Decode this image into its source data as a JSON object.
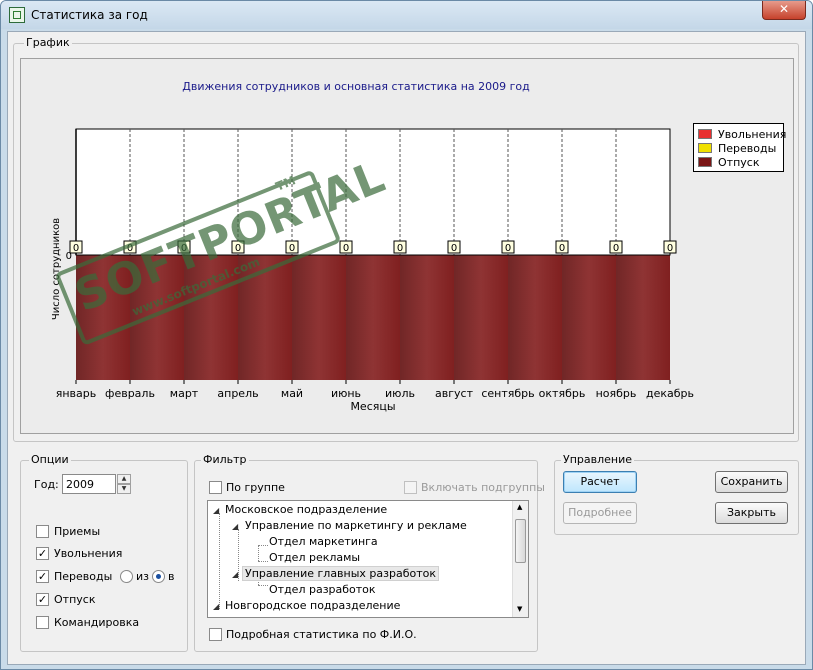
{
  "window": {
    "title": "Статистика за год",
    "close_label": "✕"
  },
  "chart_group": {
    "label": "График"
  },
  "chart_data": {
    "type": "bar",
    "title": "Движения сотрудников и основная статистика на 2009 год",
    "xlabel": "Месяцы",
    "ylabel": "Число сотрудников",
    "categories": [
      "январь",
      "февраль",
      "март",
      "апрель",
      "май",
      "июнь",
      "июль",
      "август",
      "сентябрь",
      "октябрь",
      "ноябрь",
      "декабрь"
    ],
    "series": [
      {
        "name": "Увольнения",
        "color": "#e83030",
        "values": [
          0,
          0,
          0,
          0,
          0,
          0,
          0,
          0,
          0,
          0,
          0,
          0
        ]
      },
      {
        "name": "Переводы",
        "color": "#f0e000",
        "values": [
          0,
          0,
          0,
          0,
          0,
          0,
          0,
          0,
          0,
          0,
          0,
          0
        ]
      },
      {
        "name": "Отпуск",
        "color": "#7a1515",
        "values": [
          0,
          0,
          0,
          0,
          0,
          0,
          0,
          0,
          0,
          0,
          0,
          0
        ]
      }
    ],
    "data_labels": [
      "0",
      "0",
      "0",
      "0",
      "0",
      "0",
      "0",
      "0",
      "0",
      "0",
      "0",
      "0"
    ],
    "y_zero_tick": "0",
    "grid": "vertical dashed",
    "legend_position": "top-right"
  },
  "options": {
    "label": "Опции",
    "year_label": "Год:",
    "year_value": "2009",
    "spin_up": "▲",
    "spin_down": "▼",
    "hires_label": "Приемы",
    "hires_checked": false,
    "dismissals_label": "Увольнения",
    "dismissals_checked": true,
    "transfers_label": "Переводы",
    "transfers_checked": true,
    "transfer_from_label": "из",
    "transfer_to_label": "в",
    "transfer_direction": "в",
    "vacation_label": "Отпуск",
    "vacation_checked": true,
    "business_trip_label": "Командировка",
    "business_trip_checked": false,
    "check_mark": "✓"
  },
  "filter": {
    "label": "Фильтр",
    "by_group_label": "По группе",
    "by_group_checked": false,
    "include_subgroups_label": "Включать подгруппы",
    "include_subgroups_checked": false,
    "tree_expand_glyph": "◢",
    "tree": [
      {
        "label": "Московское подразделение",
        "expanded": true
      },
      {
        "label": "Управление по маркетингу и рекламе",
        "expanded": true
      },
      {
        "label": "Отдел маркетинга"
      },
      {
        "label": "Отдел рекламы"
      },
      {
        "label": "Управление главных разработок",
        "expanded": true,
        "selected": true
      },
      {
        "label": "Отдел разработок"
      },
      {
        "label": "Новгородское подразделение",
        "expanded": true
      }
    ],
    "scroll_up": "▲",
    "scroll_down": "▼",
    "detail_stats_label": "Подробная статистика по Ф.И.О.",
    "detail_stats_checked": false
  },
  "control": {
    "label": "Управление",
    "calculate": "Расчет",
    "save": "Сохранить",
    "details": "Подробнее",
    "close": "Закрыть"
  }
}
